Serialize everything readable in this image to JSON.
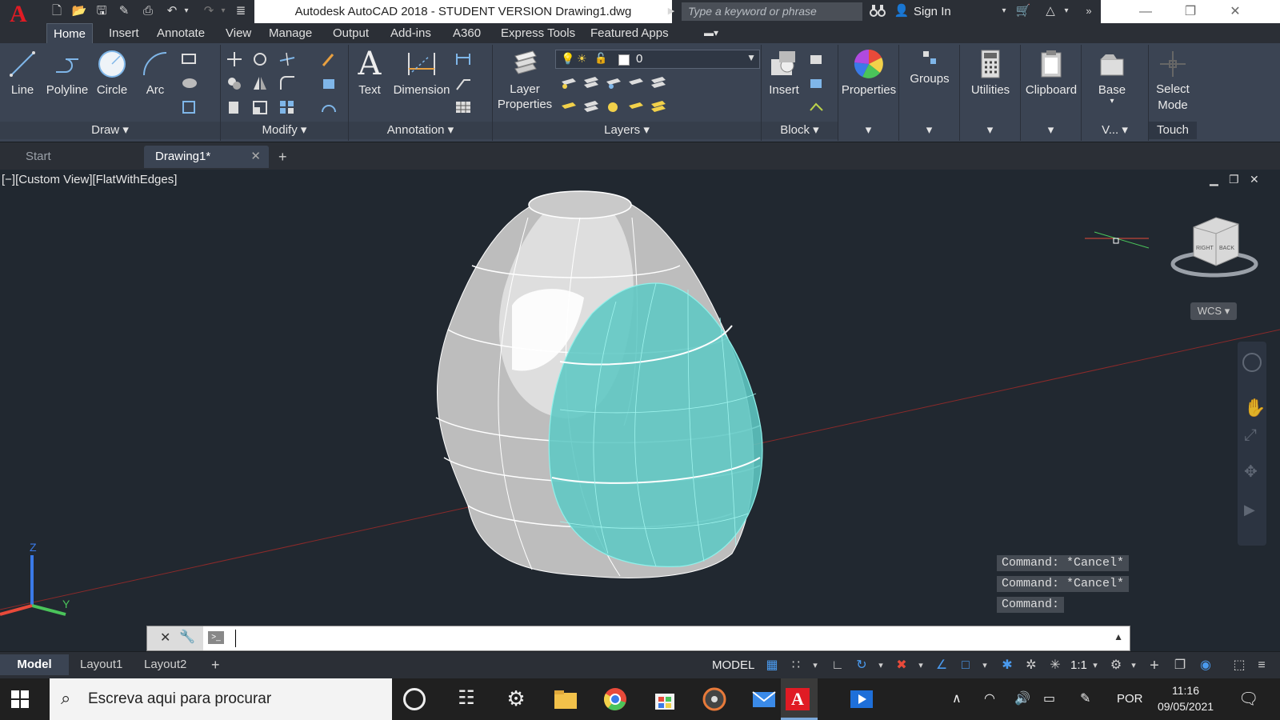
{
  "app": {
    "title": "Autodesk AutoCAD 2018 - STUDENT VERSION    Drawing1.dwg",
    "logo_letter": "A",
    "search_placeholder": "Type a keyword or phrase",
    "sign_in": "Sign In"
  },
  "ribbon_tabs": [
    "Home",
    "Insert",
    "Annotate",
    "View",
    "Manage",
    "Output",
    "Add-ins",
    "A360",
    "Express Tools",
    "Featured Apps"
  ],
  "draw_panel": {
    "title": "Draw",
    "tools": [
      "Line",
      "Polyline",
      "Circle",
      "Arc"
    ]
  },
  "modify_panel": {
    "title": "Modify"
  },
  "annotation_panel": {
    "title": "Annotation",
    "tools": [
      "Text",
      "Dimension"
    ]
  },
  "layers_panel": {
    "title": "Layers",
    "layer_props": "Layer\nProperties",
    "layer_props_l1": "Layer",
    "layer_props_l2": "Properties",
    "current_layer": "0"
  },
  "block_panel": {
    "title": "Block",
    "insert": "Insert"
  },
  "properties_panel": {
    "label": "Properties"
  },
  "groups_panel": {
    "label": "Groups"
  },
  "utilities_panel": {
    "label": "Utilities"
  },
  "clipboard_panel": {
    "label": "Clipboard"
  },
  "view_panel": {
    "base": "Base",
    "title": "V..."
  },
  "touch_panel": {
    "select_l1": "Select",
    "select_l2": "Mode",
    "title": "Touch"
  },
  "doc_tabs": [
    "Start",
    "Drawing1*"
  ],
  "viewport": {
    "label": "[−][Custom View][FlatWithEdges]",
    "wcs": "WCS",
    "cube_right": "RIGHT",
    "cube_back": "BACK",
    "ucs_z": "Z",
    "ucs_y": "Y"
  },
  "command_history": [
    "Command: *Cancel*",
    "Command: *Cancel*",
    "Command:"
  ],
  "layout_tabs": [
    "Model",
    "Layout1",
    "Layout2"
  ],
  "status": {
    "model": "MODEL",
    "scale": "1:1"
  },
  "taskbar": {
    "search_placeholder": "Escreva aqui para procurar",
    "language": "POR",
    "time": "11:16",
    "date": "09/05/2021"
  },
  "colors": {
    "ribbon_bg": "#3b4453",
    "viewport_bg": "#212830",
    "solid_cyan": "#5ec8c4",
    "autocad_red": "#e01b24"
  }
}
